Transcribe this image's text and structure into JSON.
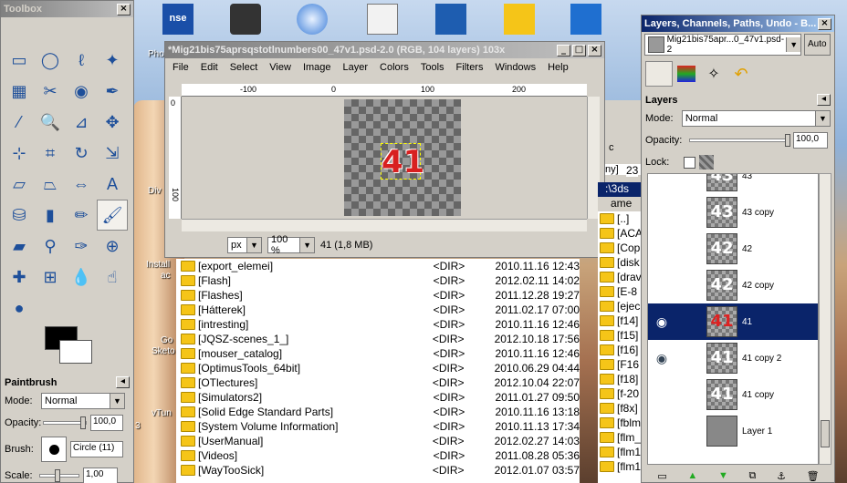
{
  "desktop": {
    "icon_labels": [
      "Phot",
      "Div",
      "Install",
      "ac",
      "Go",
      "Sketo",
      "vTun",
      "3"
    ]
  },
  "toolbox": {
    "title": "Toolbox",
    "tools": [
      "rect-select-icon",
      "ellipse-select-icon",
      "lasso-icon",
      "fuzzy-select-icon",
      "color-select-icon",
      "scissors-icon",
      "foreground-select-icon",
      "paths-icon",
      "color-picker-icon",
      "zoom-icon",
      "measure-icon",
      "move-icon",
      "align-icon",
      "crop-icon",
      "rotate-icon",
      "scale-icon",
      "shear-icon",
      "perspective-icon",
      "flip-icon",
      "text-icon",
      "bucket-fill-icon",
      "blend-icon",
      "pencil-icon",
      "paintbrush-icon",
      "eraser-icon",
      "airbrush-icon",
      "ink-icon",
      "clone-icon",
      "heal-icon",
      "perspective-clone-icon",
      "blur-icon",
      "smudge-icon",
      "dodge-icon"
    ],
    "selected_tool": "paintbrush-icon",
    "paintbrush": {
      "title": "Paintbrush",
      "mode_label": "Mode:",
      "mode_value": "Normal",
      "opacity_label": "Opacity:",
      "opacity_value": "100,0",
      "brush_label": "Brush:",
      "brush_value": "Circle (11)",
      "scale_label": "Scale:",
      "scale_value": "1,00"
    }
  },
  "image_window": {
    "title": "*Mig21bis75aprsqstotlnumbers00_47v1.psd-2.0 (RGB, 104 layers) 103x",
    "menus": [
      "File",
      "Edit",
      "Select",
      "View",
      "Image",
      "Layer",
      "Colors",
      "Tools",
      "Filters",
      "Windows",
      "Help"
    ],
    "ruler_ticks": [
      "-100",
      "0",
      "100",
      "200"
    ],
    "ruler_v_ticks": [
      "0",
      "100"
    ],
    "canvas_text": "41",
    "unit": "px",
    "zoom": "100 %",
    "status": "41 (1,8 MB)"
  },
  "file_manager": {
    "rows": [
      {
        "name": "[export_elemei]",
        "type": "<DIR>",
        "date": "2010.11.16 12:43"
      },
      {
        "name": "[Flash]",
        "type": "<DIR>",
        "date": "2012.02.11 14:02"
      },
      {
        "name": "[Flashes]",
        "type": "<DIR>",
        "date": "2011.12.28 19:27"
      },
      {
        "name": "[Hátterek]",
        "type": "<DIR>",
        "date": "2011.02.17 07:00"
      },
      {
        "name": "[intresting]",
        "type": "<DIR>",
        "date": "2010.11.16 12:46"
      },
      {
        "name": "[JQSZ-scenes_1_]",
        "type": "<DIR>",
        "date": "2012.10.18 17:56"
      },
      {
        "name": "[mouser_catalog]",
        "type": "<DIR>",
        "date": "2010.11.16 12:46"
      },
      {
        "name": "[OptimusTools_64bit]",
        "type": "<DIR>",
        "date": "2010.06.29 04:44"
      },
      {
        "name": "[OTlectures]",
        "type": "<DIR>",
        "date": "2012.10.04 22:07"
      },
      {
        "name": "[Simulators2]",
        "type": "<DIR>",
        "date": "2011.01.27 09:50"
      },
      {
        "name": "[Solid Edge Standard Parts]",
        "type": "<DIR>",
        "date": "2010.11.16 13:18"
      },
      {
        "name": "[System Volume Information]",
        "type": "<DIR>",
        "date": "2010.11.13 17:34"
      },
      {
        "name": "[UserManual]",
        "type": "<DIR>",
        "date": "2012.02.27 14:03"
      },
      {
        "name": "[Videos]",
        "type": "<DIR>",
        "date": "2011.08.28 05:36"
      },
      {
        "name": "[WayTooSick]",
        "type": "<DIR>",
        "date": "2012.01.07 03:57"
      }
    ],
    "right_panel_header": ":\\3ds",
    "right_panel_name": "ame",
    "right_rows": [
      "[..]",
      "[ACA",
      "[Cop",
      "[disk",
      "[drav",
      "[E-8",
      "[ejec",
      "[f14]",
      "[f15]",
      "[f16]",
      "[F16",
      "[f18]",
      "[f-20",
      "[f8x]",
      "[fblm",
      "[flm_",
      "[flm1",
      "[flm1"
    ],
    "ghost_texts": [
      "c",
      "ny]",
      "23"
    ]
  },
  "layers_dock": {
    "title": "Layers, Channels, Paths, Undo - B...",
    "image_selector": "Mig21bis75apr...0_47v1.psd-2",
    "auto_label": "Auto",
    "panel_title": "Layers",
    "mode_label": "Mode:",
    "mode_value": "Normal",
    "opacity_label": "Opacity:",
    "opacity_value": "100,0",
    "lock_label": "Lock:",
    "layers": [
      {
        "name": "43",
        "thumb": "43",
        "visible": false,
        "selected": false
      },
      {
        "name": "43 copy",
        "thumb": "43",
        "visible": false,
        "selected": false
      },
      {
        "name": "42",
        "thumb": "42",
        "visible": false,
        "selected": false
      },
      {
        "name": "42 copy",
        "thumb": "42",
        "visible": false,
        "selected": false
      },
      {
        "name": "41",
        "thumb": "41",
        "visible": true,
        "selected": true
      },
      {
        "name": "41 copy 2",
        "thumb": "41",
        "visible": true,
        "selected": false
      },
      {
        "name": "41 copy",
        "thumb": "41",
        "visible": false,
        "selected": false
      },
      {
        "name": "Layer 1",
        "thumb": "",
        "visible": false,
        "selected": false
      }
    ]
  }
}
